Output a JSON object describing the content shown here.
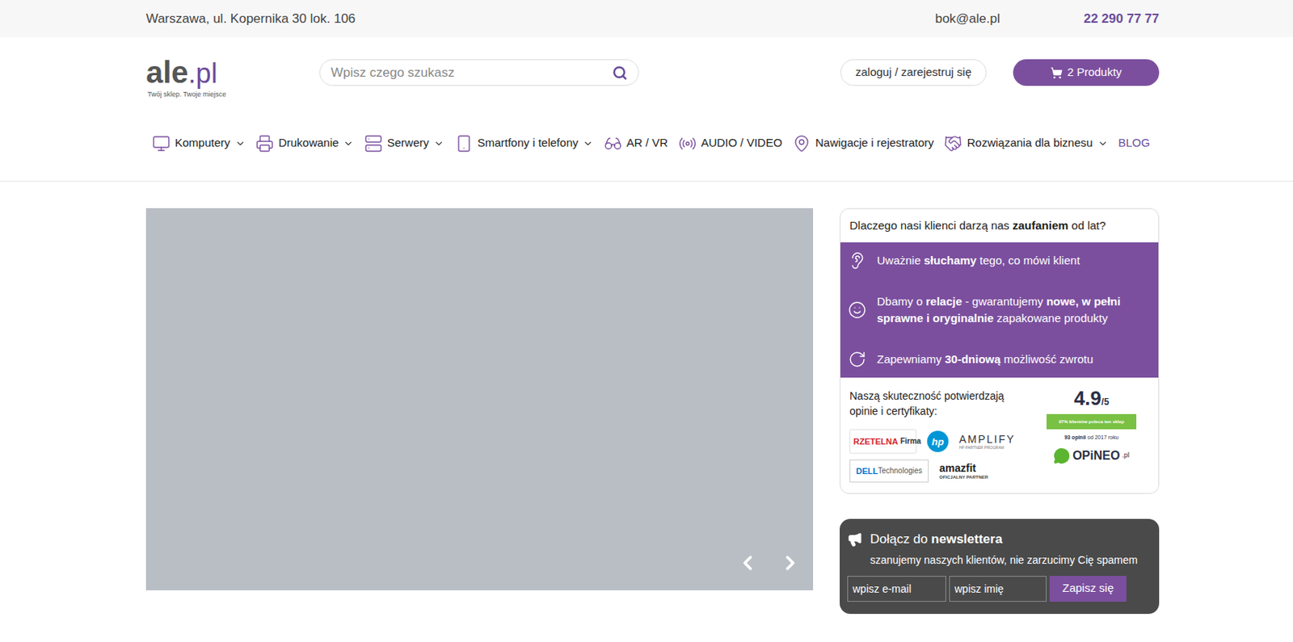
{
  "topbar": {
    "address": "Warszawa, ul. Kopernika 30 lok. 106",
    "email": "bok@ale.pl",
    "phone": "22 290 77 77"
  },
  "logo": {
    "name": "ale",
    "suffix": ".pl",
    "tagline": "Twój sklep. Twoje miejsce"
  },
  "search": {
    "placeholder": "Wpisz czego szukasz"
  },
  "login": "zaloguj / zarejestruj się",
  "cart": "2 Produkty",
  "nav": [
    {
      "label": "Komputery",
      "kind": "category",
      "dropdown": true
    },
    {
      "label": "Drukowanie",
      "kind": "category",
      "dropdown": true
    },
    {
      "label": "Serwery",
      "kind": "category",
      "dropdown": true
    },
    {
      "label": "Smartfony i telefony",
      "kind": "category",
      "dropdown": true
    },
    {
      "label": "AR / VR",
      "kind": "category",
      "dropdown": false
    },
    {
      "label": "AUDIO / VIDEO",
      "kind": "category",
      "dropdown": false
    },
    {
      "label": "Nawigacje i rejestratory",
      "kind": "category",
      "dropdown": false
    },
    {
      "label": "Rozwiązania dla biznesu",
      "kind": "category",
      "dropdown": true
    },
    {
      "label": "BLOG",
      "kind": "link",
      "dropdown": false
    }
  ],
  "trust": {
    "title": [
      {
        "text": "Dlaczego nasi klienci darzą nas ",
        "bold": false
      },
      {
        "text": "zaufaniem",
        "bold": true
      },
      {
        "text": " od lat?",
        "bold": false
      }
    ],
    "features": [
      [
        {
          "text": "Uważnie ",
          "bold": false
        },
        {
          "text": "słuchamy",
          "bold": true
        },
        {
          "text": " tego, co mówi klient",
          "bold": false
        }
      ],
      [
        {
          "text": "Dbamy o ",
          "bold": false
        },
        {
          "text": "relacje",
          "bold": true
        },
        {
          "text": " - gwarantujemy ",
          "bold": false
        },
        {
          "text": "nowe, w pełni sprawne i oryginalnie",
          "bold": true
        },
        {
          "text": " zapakowane produkty",
          "bold": false
        }
      ],
      [
        {
          "text": "Zapewniamy ",
          "bold": false
        },
        {
          "text": "30-dniową",
          "bold": true
        },
        {
          "text": " możliwość zwrotu",
          "bold": false
        }
      ]
    ],
    "proof": "Naszą skuteczność potwierdzają opinie i certyfikaty:",
    "certificates": [
      {
        "kind": "rzetelna",
        "text": "RZETELNA",
        "sub": "Firma"
      },
      {
        "kind": "hp",
        "text": "hp",
        "sub": ""
      },
      {
        "kind": "amplify",
        "text": "AMPLIFY",
        "sub": "HP PARTNER PROGRAM"
      },
      {
        "kind": "dell",
        "text": "DELL",
        "sub": "Technologies"
      },
      {
        "kind": "amazfit",
        "text": "amazfit",
        "sub": "OFICJALNY PARTNER"
      }
    ],
    "rating": {
      "score": "4.9",
      "max": "/5",
      "badge": "97% klientów poleca ten sklep",
      "count": "93 opinii",
      "since": "od 2017 roku",
      "brand": "OPiNEO",
      "brand_suffix": ".pl"
    }
  },
  "newsletter": {
    "title": [
      {
        "text": "Dołącz do ",
        "bold": false
      },
      {
        "text": "newslettera",
        "bold": true
      }
    ],
    "subtitle": "szanujemy naszych klientów, nie zarzucimy Cię spamem",
    "email_placeholder": "wpisz e-mail",
    "name_placeholder": "wpisz imię",
    "button": "Zapisz się"
  }
}
